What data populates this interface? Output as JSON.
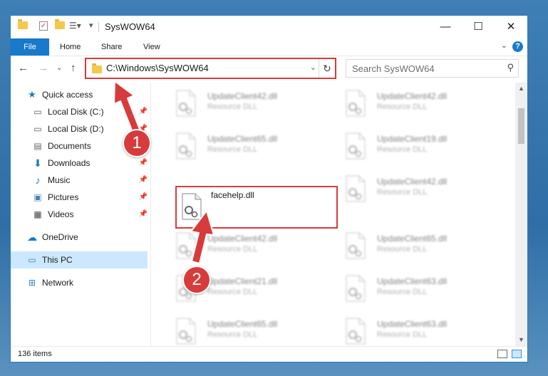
{
  "window": {
    "title": "SysWOW64"
  },
  "ribbon": {
    "tabs": [
      "File",
      "Home",
      "Share",
      "View"
    ]
  },
  "address": {
    "path": "C:\\Windows\\SysWOW64"
  },
  "search": {
    "placeholder": "Search SysWOW64"
  },
  "sidebar": {
    "items": [
      {
        "label": "Quick access",
        "icon": "star-icon"
      },
      {
        "label": "Local Disk (C:)",
        "icon": "drive-icon",
        "pinned": true
      },
      {
        "label": "Local Disk (D:)",
        "icon": "drive-icon",
        "pinned": true
      },
      {
        "label": "Documents",
        "icon": "documents-icon",
        "pinned": true
      },
      {
        "label": "Downloads",
        "icon": "download-icon",
        "pinned": true
      },
      {
        "label": "Music",
        "icon": "music-icon",
        "pinned": true
      },
      {
        "label": "Pictures",
        "icon": "pictures-icon",
        "pinned": true
      },
      {
        "label": "Videos",
        "icon": "videos-icon",
        "pinned": true
      },
      {
        "label": "OneDrive",
        "icon": "cloud-icon"
      },
      {
        "label": "This PC",
        "icon": "computer-icon",
        "selected": true
      },
      {
        "label": "Network",
        "icon": "network-icon"
      }
    ]
  },
  "files": {
    "left": [
      {
        "name": "UpdateClient42.dll",
        "desc": "Resource DLL"
      },
      {
        "name": "UpdateClient65.dll",
        "desc": "Resource DLL"
      },
      {
        "name": "facehelp.dll",
        "desc": ""
      },
      {
        "name": "UpdateClient42.dll",
        "desc": "Resource DLL"
      },
      {
        "name": "UpdateClient21.dll",
        "desc": "Resource DLL"
      },
      {
        "name": "UpdateClient65.dll",
        "desc": "Resource DLL"
      }
    ],
    "right": [
      {
        "name": "UpdateClient42.dll",
        "desc": "Resource DLL"
      },
      {
        "name": "UpdateClient19.dll",
        "desc": "Resource DLL"
      },
      {
        "name": "UpdateClient42.dll",
        "desc": "Resource DLL"
      },
      {
        "name": "UpdateClient65.dll",
        "desc": "Resource DLL"
      },
      {
        "name": "UpdateClient63.dll",
        "desc": "Resource DLL"
      },
      {
        "name": "UpdateClient63.dll",
        "desc": "Resource DLL"
      }
    ]
  },
  "status": {
    "count": "136 items"
  },
  "annotations": {
    "step1": "1",
    "step2": "2"
  },
  "colors": {
    "accent": "#1979ca",
    "highlight": "#d83b3b",
    "selected": "#cce8ff"
  }
}
